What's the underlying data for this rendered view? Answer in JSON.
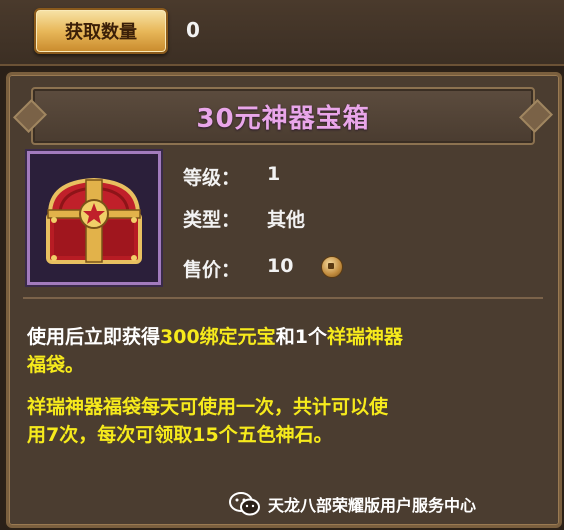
{
  "acquire": {
    "button_label": "获取数量",
    "value": "0"
  },
  "item": {
    "title": "30元神器宝箱",
    "attributes": [
      {
        "label": "等级：",
        "value": "1"
      },
      {
        "label": "类型：",
        "value": "其他"
      },
      {
        "label": "售价：",
        "value": "10"
      }
    ],
    "currency_icon": "coin-icon"
  },
  "description": {
    "line1_a": "使用后立即获得",
    "line1_b": "300绑定元宝",
    "line1_c": "和1个",
    "line1_d": "祥瑞神器",
    "line2": "福袋。",
    "para2_line1": "祥瑞神器福袋每天可使用一次，共计可以使",
    "para2_line2": "用7次，每次可领取15个五色神石。"
  },
  "footer": {
    "text": "天龙八部荣耀版用户服务中心",
    "icon": "wechat-icon"
  },
  "colors": {
    "title": "#e9a6e9",
    "highlight": "#f6ea1c",
    "panel": "#4b3d30"
  }
}
